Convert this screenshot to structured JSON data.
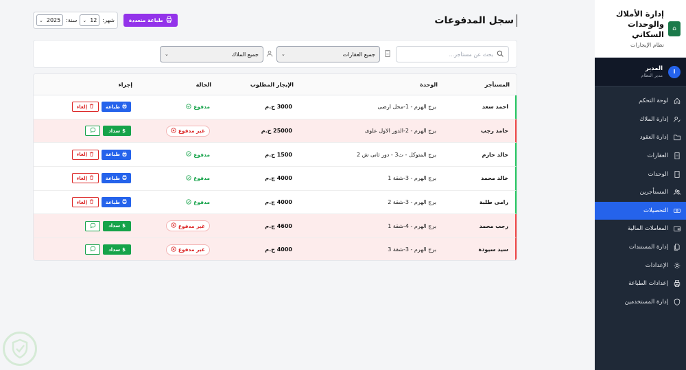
{
  "header": {
    "title": "سجل المدفوعات",
    "multi_print_label": "طباعة متعددة",
    "month_label": "شهر:",
    "month_value": "12",
    "year_label": "سنة:",
    "year_value": "2025"
  },
  "filters": {
    "search_placeholder": "بحث عن مستأجر...",
    "property_select": "جميع العقارات",
    "owner_select": "جميع الملاك"
  },
  "table": {
    "columns": {
      "tenant": "المستأجر",
      "unit": "الوحدة",
      "rent": "الإيجار المطلوب",
      "status": "الحالة",
      "action": "إجراء"
    },
    "labels": {
      "paid": "مدفوع",
      "unpaid": "غير مدفوع",
      "print": "طباعة",
      "cancel": "إلغاء",
      "pay": "سداد"
    },
    "rows": [
      {
        "tenant": "احمد سعد",
        "unit": "برج الهرم - 1-محل ارضى",
        "rent": "3000 ج.م",
        "status": "paid"
      },
      {
        "tenant": "حامد رجب",
        "unit": "برج الهرم - 2-الدور الاول علوى",
        "rent": "25000 ج.م",
        "status": "unpaid"
      },
      {
        "tenant": "خالد حازم",
        "unit": "برج المتوكل - ث3 - دور ثانى ش 2",
        "rent": "1500 ج.م",
        "status": "paid"
      },
      {
        "tenant": "خالد محمد",
        "unit": "برج الهرم - 3-شقة 1",
        "rent": "4000 ج.م",
        "status": "paid"
      },
      {
        "tenant": "رامى طلبة",
        "unit": "برج الهرم - 3-شقة 2",
        "rent": "4000 ج.م",
        "status": "paid"
      },
      {
        "tenant": "رجب محمد",
        "unit": "برج الهرم - 4-شقة 1",
        "rent": "4600 ج.م",
        "status": "unpaid"
      },
      {
        "tenant": "سيد سيودة",
        "unit": "برج الهرم - 3-شقة 3",
        "rent": "4000 ج.م",
        "status": "unpaid"
      }
    ]
  },
  "sidebar": {
    "title": "إدارة الأملاك والوحدات السكاني",
    "subtitle": "نظام الإيجارات",
    "user_name": "المدير",
    "user_role": "مدير النظام",
    "avatar_letter": "ا",
    "items": [
      {
        "label": "لوحة التحكم",
        "icon": "home-icon"
      },
      {
        "label": "إدارة الملاك",
        "icon": "user-check-icon"
      },
      {
        "label": "إدارة العقود",
        "icon": "folder-icon"
      },
      {
        "label": "العقارات",
        "icon": "building-icon"
      },
      {
        "label": "الوحدات",
        "icon": "door-icon"
      },
      {
        "label": "المستأجرين",
        "icon": "users-icon"
      },
      {
        "label": "التحصيلات",
        "icon": "cash-icon",
        "active": true
      },
      {
        "label": "المعاملات المالية",
        "icon": "wallet-icon"
      },
      {
        "label": "إدارة المستندات",
        "icon": "documents-icon"
      },
      {
        "label": "الإعدادات",
        "icon": "gear-icon"
      },
      {
        "label": "إعدادات الطباعة",
        "icon": "printer-icon"
      },
      {
        "label": "إدارة المستخدمين",
        "icon": "shield-icon"
      }
    ]
  },
  "colors": {
    "primary": "#2563eb",
    "purple": "#9333ea",
    "success": "#16a34a",
    "danger": "#dc2626",
    "sidebar_bg": "#1f2937"
  }
}
